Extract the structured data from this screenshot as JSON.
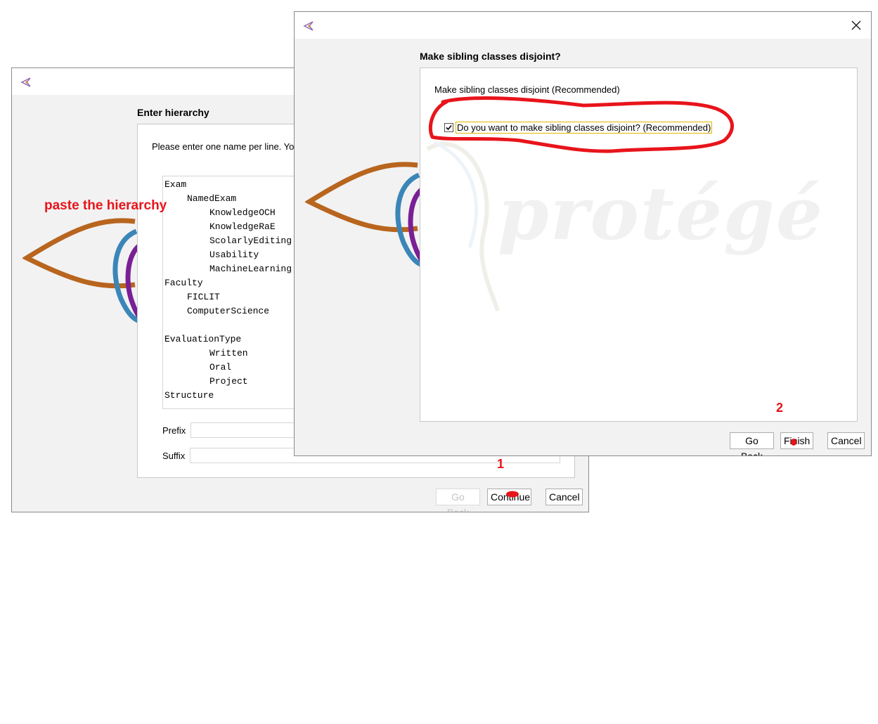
{
  "back_dialog": {
    "heading": "Enter hierarchy",
    "instruction": "Please enter one name per line. Yo",
    "hierarchy_lines": [
      {
        "text": "Exam",
        "indent": 0
      },
      {
        "text": "NamedExam",
        "indent": 1
      },
      {
        "text": "KnowledgeOCH",
        "indent": 2
      },
      {
        "text": "KnowledgeRaE",
        "indent": 2
      },
      {
        "text": "ScolarlyEditing",
        "indent": 2
      },
      {
        "text": "Usability",
        "indent": 2
      },
      {
        "text": "MachineLearning",
        "indent": 2
      },
      {
        "text": "Faculty",
        "indent": 0
      },
      {
        "text": "FICLIT",
        "indent": 1
      },
      {
        "text": "ComputerScience",
        "indent": 1
      },
      {
        "text": "",
        "indent": 0
      },
      {
        "text": "EvaluationType",
        "indent": 0
      },
      {
        "text": "Written",
        "indent": 2
      },
      {
        "text": "Oral",
        "indent": 2
      },
      {
        "text": "Project",
        "indent": 2
      },
      {
        "text": "Structure",
        "indent": 0
      }
    ],
    "prefix_label": "Prefix",
    "suffix_label": "Suffix",
    "prefix_value": "",
    "suffix_value": "",
    "go_back_label": "Go Back",
    "continue_label": "Continue",
    "cancel_label": "Cancel"
  },
  "front_dialog": {
    "heading": "Make sibling classes disjoint?",
    "section_label": "Make sibling classes disjoint (Recommended)",
    "checkbox_label": "Do you want to make sibling classes disjoint? (Recommended)",
    "checkbox_checked": true,
    "watermark": "protégé",
    "go_back_label": "Go Back",
    "finish_label": "Finish",
    "cancel_label": "Cancel"
  },
  "annotations": {
    "paste_note": "paste the hierarchy",
    "step_1": "1",
    "step_2": "2",
    "annotation_color": "#e8141b"
  },
  "colors": {
    "dialog_bg": "#f2f2f2",
    "logo_orange": "#b8651e",
    "logo_blue": "#3b86b8",
    "logo_purple": "#7a1f95",
    "focus_border": "#e0b400"
  }
}
